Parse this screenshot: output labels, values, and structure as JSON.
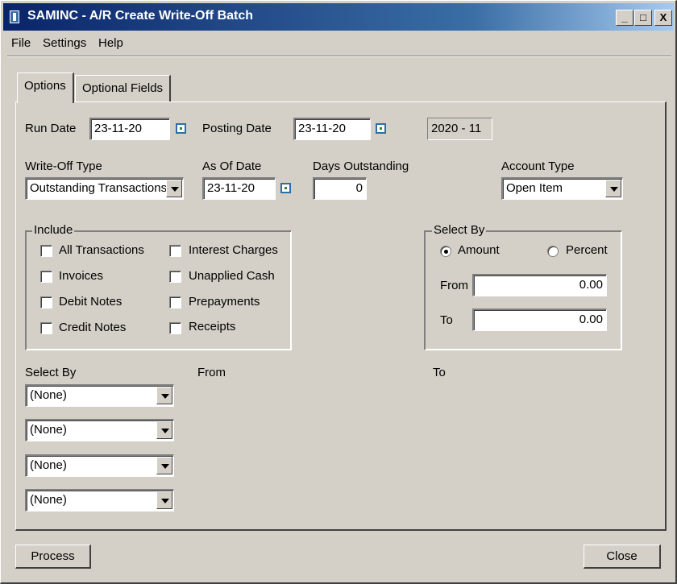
{
  "window": {
    "title": "SAMINC - A/R Create Write-Off Batch",
    "controls": {
      "minimize": "_",
      "maximize": "□",
      "close": "X"
    }
  },
  "menu": [
    "File",
    "Settings",
    "Help"
  ],
  "tabs": [
    "Options",
    "Optional Fields"
  ],
  "run_date": {
    "label": "Run Date",
    "value": "23-11-20"
  },
  "posting_date": {
    "label": "Posting Date",
    "value": "23-11-20"
  },
  "fiscal_period": "2020 - 11",
  "write_off_type": {
    "label": "Write-Off Type",
    "value": "Outstanding Transactions"
  },
  "as_of_date": {
    "label": "As Of Date",
    "value": "23-11-20"
  },
  "days_outstanding": {
    "label": "Days Outstanding",
    "value": "0"
  },
  "account_type": {
    "label": "Account Type",
    "value": "Open Item"
  },
  "include": {
    "title": "Include",
    "items": [
      {
        "label": "All Transactions",
        "checked": false
      },
      {
        "label": "Interest Charges",
        "checked": false
      },
      {
        "label": "Invoices",
        "checked": false
      },
      {
        "label": "Unapplied Cash",
        "checked": false
      },
      {
        "label": "Debit Notes",
        "checked": false
      },
      {
        "label": "Prepayments",
        "checked": false
      },
      {
        "label": "Credit Notes",
        "checked": false
      },
      {
        "label": "Receipts",
        "checked": false
      }
    ]
  },
  "select_by_amount": {
    "title": "Select By",
    "amount_label": "Amount",
    "percent_label": "Percent",
    "selected": "Amount",
    "from_label": "From",
    "from_value": "0.00",
    "to_label": "To",
    "to_value": "0.00"
  },
  "select_by_criteria": {
    "label": "Select By",
    "from_label": "From",
    "to_label": "To",
    "rows": [
      "(None)",
      "(None)",
      "(None)",
      "(None)"
    ]
  },
  "buttons": {
    "process": "Process",
    "close": "Close"
  }
}
